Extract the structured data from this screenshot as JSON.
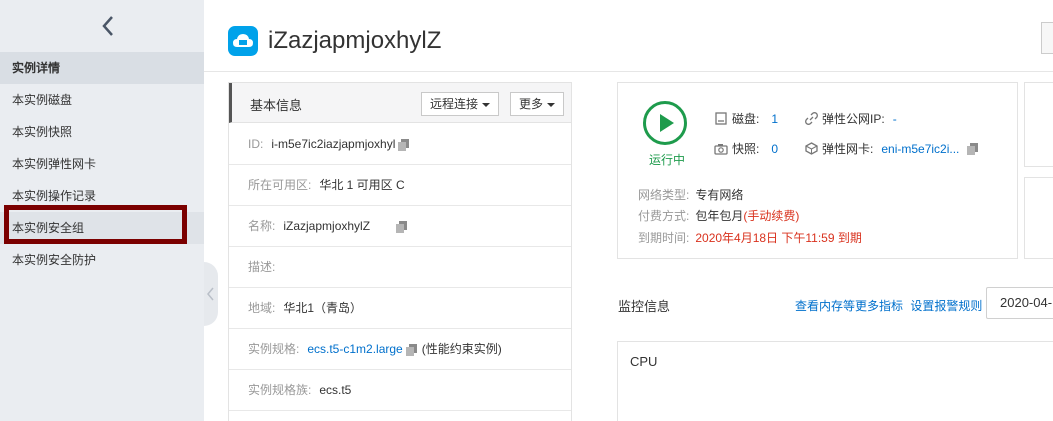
{
  "sidebar": {
    "items": [
      {
        "label": "实例详情"
      },
      {
        "label": "本实例磁盘"
      },
      {
        "label": "本实例快照"
      },
      {
        "label": "本实例弹性网卡"
      },
      {
        "label": "本实例操作记录"
      },
      {
        "label": "本实例安全组"
      },
      {
        "label": "本实例安全防护"
      }
    ]
  },
  "header": {
    "title": "iZazjapmjoxhylZ"
  },
  "basic_info": {
    "title": "基本信息",
    "remote_connect_label": "远程连接",
    "more_label": "更多",
    "rows": {
      "id_label": "ID:",
      "id_value": "i-m5e7ic2iazjapmjoxhyl",
      "zone_label": "所在可用区:",
      "zone_value": "华北 1 可用区 C",
      "name_label": "名称:",
      "name_value": "iZazjapmjoxhylZ",
      "desc_label": "描述:",
      "region_label": "地域:",
      "region_value": "华北1（青岛）",
      "spec_label": "实例规格:",
      "spec_value": "ecs.t5-c1m2.large",
      "spec_note": "(性能约束实例)",
      "family_label": "实例规格族:",
      "family_value": "ecs.t5"
    }
  },
  "status": {
    "state_label": "运行中",
    "disk_label": "磁盘:",
    "disk_count": "1",
    "snapshot_label": "快照:",
    "snapshot_count": "0",
    "eip_label": "弹性公网IP:",
    "eip_value": "-",
    "eni_label": "弹性网卡:",
    "eni_value": "eni-m5e7ic2i...",
    "network_type_label": "网络类型:",
    "network_type_value": "专有网络",
    "billing_label": "付费方式:",
    "billing_value": "包年包月",
    "billing_note": "(手动续费)",
    "expire_label": "到期时间:",
    "expire_value": "2020年4月18日 下午11:59 到期"
  },
  "monitoring": {
    "title": "监控信息",
    "link_more_metrics": "查看内存等更多指标",
    "link_alarm_rules": "设置报警规则",
    "date_value": "2020-04-",
    "cpu_label": "CPU"
  },
  "colors": {
    "accent_orange": "#f37021",
    "link_blue": "#0070cc",
    "running_green": "#1e9b4c",
    "warning_red": "#d9321e",
    "highlight_box": "#7b0000"
  }
}
